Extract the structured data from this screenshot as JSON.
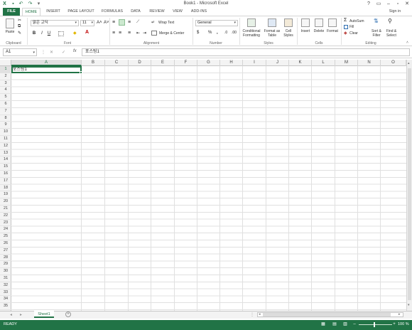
{
  "app": {
    "window_title": "Book1 - Microsoft Excel",
    "sign_in": "Sign in",
    "help": "?"
  },
  "tabs": [
    "FILE",
    "HOME",
    "INSERT",
    "PAGE LAYOUT",
    "FORMULAS",
    "DATA",
    "REVIEW",
    "VIEW",
    "ADD-INS"
  ],
  "ribbon": {
    "clipboard": {
      "paste": "Paste",
      "group": "Clipboard"
    },
    "font": {
      "name": "맑은 고딕",
      "size": "11",
      "bold": "B",
      "italic": "I",
      "underline": "U",
      "group": "Font"
    },
    "alignment": {
      "wrap": "Wrap Text",
      "merge": "Merge & Center",
      "group": "Alignment"
    },
    "number": {
      "format": "General",
      "currency": "$",
      "percent": "%",
      "comma": ",",
      "group": "Number"
    },
    "styles": {
      "conditional_1": "Conditional",
      "conditional_2": "Formatting",
      "format_as_1": "Format as",
      "format_as_2": "Table",
      "cell_styles_1": "Cell",
      "cell_styles_2": "Styles",
      "group": "Styles"
    },
    "cells": {
      "insert": "Insert",
      "delete": "Delete",
      "format": "Format",
      "group": "Cells"
    },
    "editing": {
      "autosum": "AutoSum",
      "fill": "Fill",
      "clear": "Clear",
      "sort_1": "Sort &",
      "sort_2": "Filter",
      "find_1": "Find &",
      "find_2": "Select",
      "group": "Editing"
    }
  },
  "formula_bar": {
    "cell_ref": "A1",
    "fx": "fx",
    "content": "포스팅1"
  },
  "columns": [
    "A",
    "B",
    "C",
    "D",
    "E",
    "F",
    "G",
    "H",
    "I",
    "J",
    "K",
    "L",
    "M",
    "N",
    "O"
  ],
  "rows": [
    "1",
    "2",
    "3",
    "4",
    "5",
    "6",
    "7",
    "8",
    "9",
    "10",
    "11",
    "12",
    "13",
    "14",
    "15",
    "16",
    "17",
    "18",
    "19",
    "20",
    "21",
    "22",
    "23",
    "24",
    "25",
    "26",
    "27",
    "28",
    "29",
    "30",
    "31",
    "32",
    "33",
    "34",
    "35"
  ],
  "cells": {
    "A1": "포스팅1"
  },
  "sheets": {
    "active": "Sheet1"
  },
  "status": {
    "text": "READY",
    "zoom": "100 %"
  },
  "colors": {
    "accent": "#217346"
  }
}
